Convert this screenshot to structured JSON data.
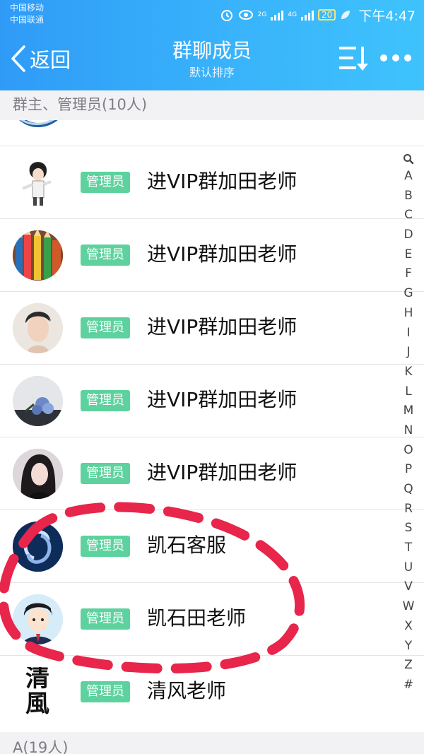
{
  "status_bar": {
    "carrier_1": "中国移动",
    "carrier_2": "中国联通",
    "net_1": "2G",
    "net_2": "4G",
    "battery": "20",
    "time": "下午4:47"
  },
  "header": {
    "back_label": "返回",
    "title": "群聊成员",
    "subtitle": "默认排序"
  },
  "sections": {
    "admins": "群主、管理员(10人)",
    "a_group": "A(19人)"
  },
  "members": [
    {
      "role": "管理员",
      "name": "进VIP群加田老师"
    },
    {
      "role": "管理员",
      "name": "进VIP群加田老师"
    },
    {
      "role": "管理员",
      "name": "进VIP群加田老师"
    },
    {
      "role": "管理员",
      "name": "进VIP群加田老师"
    },
    {
      "role": "管理员",
      "name": "进VIP群加田老师"
    },
    {
      "role": "管理员",
      "name": "凯石客服"
    },
    {
      "role": "管理员",
      "name": "凯石田老师"
    },
    {
      "role": "管理员",
      "name": "清风老师"
    }
  ],
  "avatar_text": {
    "calligraphy_1": "清",
    "calligraphy_2": "風"
  },
  "index_letters": [
    "A",
    "B",
    "C",
    "D",
    "E",
    "F",
    "G",
    "H",
    "I",
    "J",
    "K",
    "L",
    "M",
    "N",
    "O",
    "P",
    "Q",
    "R",
    "S",
    "T",
    "U",
    "V",
    "W",
    "X",
    "Y",
    "Z",
    "#"
  ],
  "colors": {
    "header_start": "#2f9bf7",
    "header_end": "#3fc3fc",
    "badge": "#5ed29e",
    "annotation": "#e8254a"
  }
}
